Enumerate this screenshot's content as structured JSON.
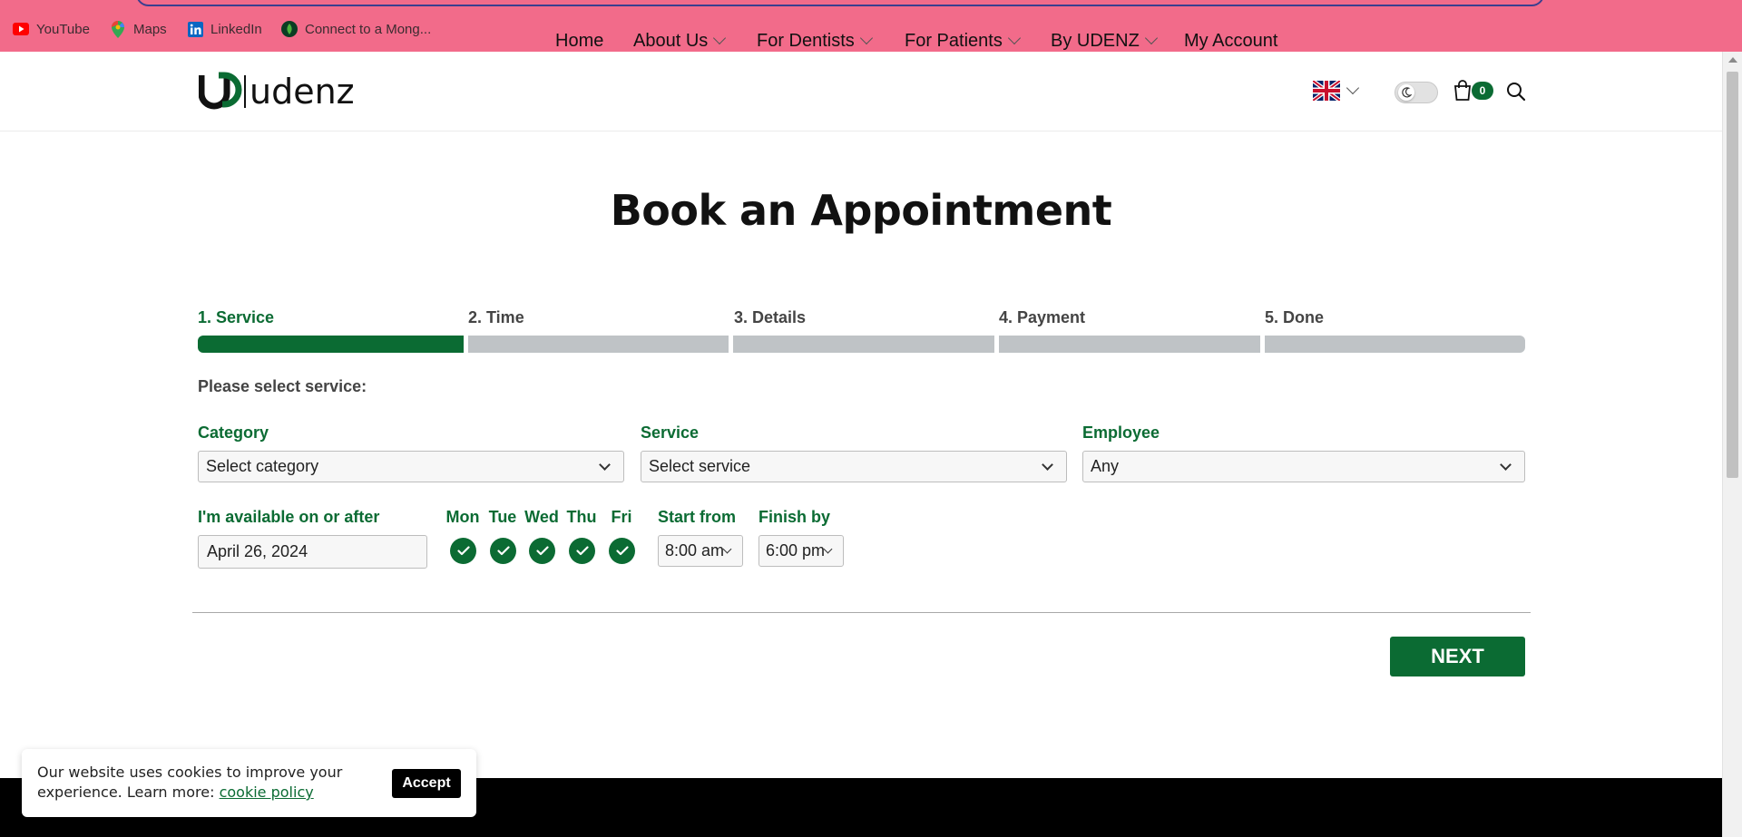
{
  "bookmarks": [
    {
      "label": "YouTube",
      "icon": "youtube-icon"
    },
    {
      "label": "Maps",
      "icon": "maps-icon"
    },
    {
      "label": "LinkedIn",
      "icon": "linkedin-icon"
    },
    {
      "label": "Connect to a Mong...",
      "icon": "mongodb-icon"
    }
  ],
  "header": {
    "logo_text": "udenz",
    "nav": [
      {
        "label": "Home",
        "has_dropdown": false
      },
      {
        "label": "About Us",
        "has_dropdown": true
      },
      {
        "label": "For Dentists",
        "has_dropdown": true
      },
      {
        "label": "For Patients",
        "has_dropdown": true
      },
      {
        "label": "By UDENZ",
        "has_dropdown": true
      },
      {
        "label": "My Account",
        "has_dropdown": false
      }
    ],
    "language_icon": "uk-flag-icon",
    "cart_count": "0"
  },
  "page": {
    "title": "Book an Appointment"
  },
  "steps": [
    {
      "label": "1. Service",
      "active": true
    },
    {
      "label": "2. Time",
      "active": false
    },
    {
      "label": "3. Details",
      "active": false
    },
    {
      "label": "4. Payment",
      "active": false
    },
    {
      "label": "5. Done",
      "active": false
    }
  ],
  "form": {
    "prompt": "Please select service:",
    "category": {
      "label": "Category",
      "value": "Select category"
    },
    "service": {
      "label": "Service",
      "value": "Select service"
    },
    "employee": {
      "label": "Employee",
      "value": "Any"
    },
    "availability": {
      "label": "I'm available on or after",
      "value": "April 26, 2024"
    },
    "days": [
      {
        "label": "Mon",
        "checked": true
      },
      {
        "label": "Tue",
        "checked": true
      },
      {
        "label": "Wed",
        "checked": true
      },
      {
        "label": "Thu",
        "checked": true
      },
      {
        "label": "Fri",
        "checked": true
      }
    ],
    "start_from": {
      "label": "Start from",
      "value": "8:00 am"
    },
    "finish_by": {
      "label": "Finish by",
      "value": "6:00 pm"
    },
    "next_label": "NEXT"
  },
  "cookie": {
    "text": "Our website uses cookies to improve your experience. Learn more:",
    "link": "cookie policy",
    "accept_label": "Accept"
  },
  "colors": {
    "accent": "#0b6b33",
    "bookmark_bar": "#f26b8a",
    "step_inactive": "#bfc3c6"
  }
}
